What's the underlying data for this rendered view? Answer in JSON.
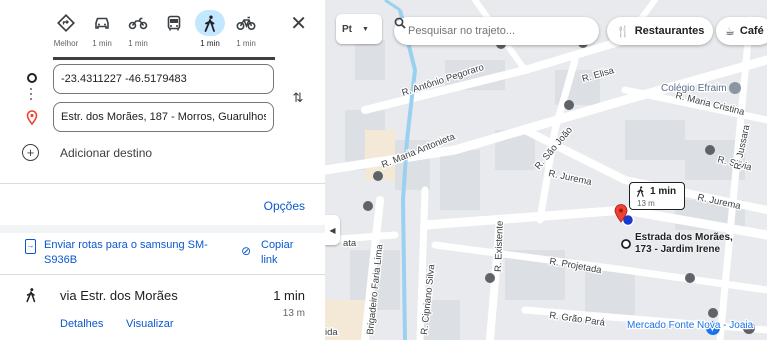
{
  "travel_modes": [
    {
      "name": "best",
      "icon": "diamond-directions-icon",
      "time": "Melhor"
    },
    {
      "name": "car",
      "icon": "car-icon",
      "time": "1 min"
    },
    {
      "name": "motorcycle",
      "icon": "motorcycle-icon",
      "time": "1 min"
    },
    {
      "name": "transit",
      "icon": "bus-icon",
      "time": ""
    },
    {
      "name": "walking",
      "icon": "walking-icon",
      "time": "1 min",
      "selected": true
    },
    {
      "name": "bicycle",
      "icon": "bicycle-icon",
      "time": "1 min"
    }
  ],
  "close_label": "✕",
  "origin": {
    "value": "-23.4311227 -46.5179483"
  },
  "destination": {
    "value": "Estr. dos Morães, 187 - Morros, Guarulhos"
  },
  "add_destination": "Adicionar destino",
  "options_label": "Opções",
  "send": {
    "label": "Enviar rotas para o samsung SM-S936B",
    "copy_label": "Copiar link"
  },
  "route": {
    "via": "via Estr. dos Morães",
    "time": "1 min",
    "distance": "13 m",
    "details_label": "Detalhes",
    "preview_label": "Visualizar"
  },
  "map": {
    "layers_label": "Pt",
    "search_placeholder": "Pesquisar no trajeto...",
    "chips": [
      {
        "icon": "restaurant-icon",
        "label": "Restaurantes"
      },
      {
        "icon": "coffee-icon",
        "label": "Café"
      }
    ],
    "bubble": {
      "time": "1 min",
      "distance": "13 m"
    },
    "destination_label": "Estrada dos Morães, 173 - Jardim Irene",
    "street_labels": {
      "antonio_pegoraro": "R. Antônio Pegoraro",
      "elisa": "R. Elisa",
      "maria_cristina": "R. Maria Cristina",
      "maria_antonieta": "R. Maria Antonieta",
      "sao_joao": "R. São João",
      "jurema_1": "R. Jurema",
      "jurema_2": "R. Jurema",
      "silvia": "R. Silvia",
      "jussara": "R. Jussara",
      "projetada": "R. Projetada",
      "grao_para": "R. Grão Pará",
      "existente": "R. Existente",
      "cipriano_silva": "R. Cipriano Silva",
      "faria_lima": "Brigadeiro Faria Lima",
      "fragment_ata": "ata",
      "fragment_ida": "ida"
    },
    "pois": {
      "colegio": "Colégio Efraim",
      "mercado": "Mercado Fonte Nova - Joaia"
    },
    "colors": {
      "water": "#9bd1f0",
      "road": "#ffffff",
      "building": "#dcdfe3",
      "block": "#e8eaed",
      "route_pin": "#ea4335",
      "origin_pin": "#1a3acd"
    }
  }
}
